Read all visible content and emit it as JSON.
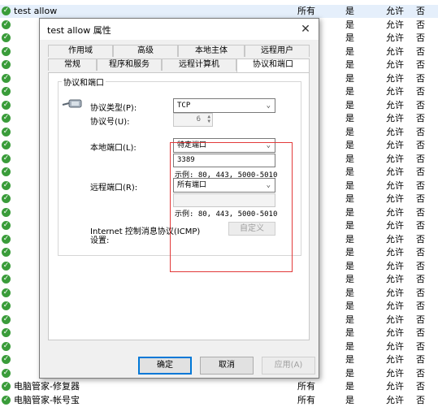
{
  "list": {
    "rows": [
      {
        "name": "test allow",
        "profile": "所有",
        "enabled": "是",
        "action": "允许",
        "override": "否"
      },
      {
        "name": "",
        "profile": "",
        "enabled": "是",
        "action": "允许",
        "override": "否"
      },
      {
        "name": "",
        "profile": "",
        "enabled": "是",
        "action": "允许",
        "override": "否"
      },
      {
        "name": "",
        "profile": "",
        "enabled": "是",
        "action": "允许",
        "override": "否"
      },
      {
        "name": "",
        "profile": "",
        "enabled": "是",
        "action": "允许",
        "override": "否"
      },
      {
        "name": "",
        "profile": "",
        "enabled": "是",
        "action": "允许",
        "override": "否"
      },
      {
        "name": "",
        "profile": "",
        "enabled": "是",
        "action": "允许",
        "override": "否"
      },
      {
        "name": "",
        "profile": "",
        "enabled": "是",
        "action": "允许",
        "override": "否"
      },
      {
        "name": "",
        "profile": "",
        "enabled": "是",
        "action": "允许",
        "override": "否"
      },
      {
        "name": "",
        "profile": "",
        "enabled": "是",
        "action": "允许",
        "override": "否"
      },
      {
        "name": "",
        "profile": "",
        "enabled": "是",
        "action": "允许",
        "override": "否"
      },
      {
        "name": "",
        "profile": "",
        "enabled": "是",
        "action": "允许",
        "override": "否"
      },
      {
        "name": "",
        "profile": "",
        "enabled": "是",
        "action": "允许",
        "override": "否"
      },
      {
        "name": "",
        "profile": "",
        "enabled": "是",
        "action": "允许",
        "override": "否"
      },
      {
        "name": "",
        "profile": "",
        "enabled": "是",
        "action": "允许",
        "override": "否"
      },
      {
        "name": "",
        "profile": "",
        "enabled": "是",
        "action": "允许",
        "override": "否"
      },
      {
        "name": "",
        "profile": "",
        "enabled": "是",
        "action": "允许",
        "override": "否"
      },
      {
        "name": "",
        "profile": "",
        "enabled": "是",
        "action": "允许",
        "override": "否"
      },
      {
        "name": "",
        "profile": "",
        "enabled": "是",
        "action": "允许",
        "override": "否"
      },
      {
        "name": "",
        "profile": "",
        "enabled": "是",
        "action": "允许",
        "override": "否"
      },
      {
        "name": "",
        "profile": "",
        "enabled": "是",
        "action": "允许",
        "override": "否"
      },
      {
        "name": "",
        "profile": "",
        "enabled": "是",
        "action": "允许",
        "override": "否"
      },
      {
        "name": "",
        "profile": "",
        "enabled": "是",
        "action": "允许",
        "override": "否"
      },
      {
        "name": "",
        "profile": "",
        "enabled": "是",
        "action": "允许",
        "override": "否"
      },
      {
        "name": "",
        "profile": "",
        "enabled": "是",
        "action": "允许",
        "override": "否"
      },
      {
        "name": "",
        "profile": "",
        "enabled": "是",
        "action": "允许",
        "override": "否"
      },
      {
        "name": "",
        "profile": "",
        "enabled": "是",
        "action": "允许",
        "override": "否"
      },
      {
        "name": "",
        "profile": "",
        "enabled": "是",
        "action": "允许",
        "override": "否"
      },
      {
        "name": "电脑管家-修复器",
        "profile": "所有",
        "enabled": "是",
        "action": "允许",
        "override": "否"
      },
      {
        "name": "电脑管家-帐号宝",
        "profile": "所有",
        "enabled": "是",
        "action": "允许",
        "override": "否"
      }
    ]
  },
  "dialog": {
    "title": "test allow 属性",
    "close": "✕",
    "tabs_row1": [
      "作用域",
      "高级",
      "本地主体",
      "远程用户"
    ],
    "tabs_row2": [
      "常规",
      "程序和服务",
      "远程计算机",
      "协议和端口"
    ],
    "group_title": "协议和端口",
    "protocol_type_label": "协议类型(P):",
    "protocol_type_value": "TCP",
    "protocol_number_label": "协议号(U):",
    "protocol_number_value": "6",
    "local_port_label": "本地端口(L):",
    "local_port_select": "特定端口",
    "local_port_value": "3389",
    "local_port_hint": "示例: 80, 443, 5000-5010",
    "remote_port_label": "远程端口(R):",
    "remote_port_select": "所有端口",
    "remote_port_value": "",
    "remote_port_hint": "示例: 80, 443, 5000-5010",
    "icmp_label": "Internet 控制消息协议(ICMP)设置:",
    "customize_button": "自定义",
    "ok_button": "确定",
    "cancel_button": "取消",
    "apply_button": "应用(A)"
  },
  "colors": {
    "highlight": "#e23a3a",
    "check": "#3a9c3a"
  }
}
